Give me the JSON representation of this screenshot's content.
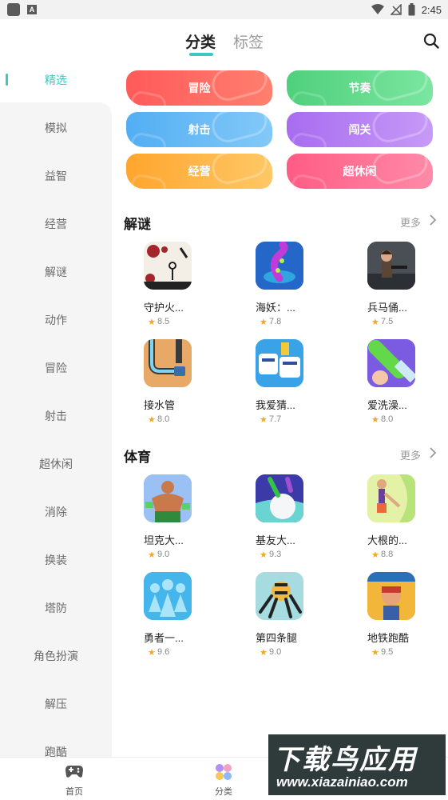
{
  "status_bar": {
    "time": "2:45"
  },
  "header": {
    "tabs": [
      {
        "label": "分类"
      },
      {
        "label": "标签"
      }
    ]
  },
  "sidebar": {
    "items": [
      {
        "label": "精选"
      },
      {
        "label": "模拟"
      },
      {
        "label": "益智"
      },
      {
        "label": "经营"
      },
      {
        "label": "解谜"
      },
      {
        "label": "动作"
      },
      {
        "label": "冒险"
      },
      {
        "label": "射击"
      },
      {
        "label": "超休闲"
      },
      {
        "label": "消除"
      },
      {
        "label": "换装"
      },
      {
        "label": "塔防"
      },
      {
        "label": "角色扮演"
      },
      {
        "label": "解压"
      },
      {
        "label": "跑酷"
      }
    ]
  },
  "categories": [
    {
      "label": "冒险",
      "color": "#ff6464"
    },
    {
      "label": "节奏",
      "color": "#5cd68a"
    },
    {
      "label": "射击",
      "color": "#5fb8f5"
    },
    {
      "label": "闯关",
      "color": "#b27bf2"
    },
    {
      "label": "经营",
      "color": "#ffb23e"
    },
    {
      "label": "超休闲",
      "color": "#ff6a8e"
    }
  ],
  "sections": [
    {
      "title": "解谜",
      "more": "更多",
      "games": [
        {
          "name": "守护火...",
          "score": "8.5",
          "icon": "stickman-icon"
        },
        {
          "name": "海妖：...",
          "score": "7.8",
          "icon": "octopus-icon"
        },
        {
          "name": "兵马俑...",
          "score": "7.5",
          "icon": "soldier-icon"
        },
        {
          "name": "接水管",
          "score": "8.0",
          "icon": "pipe-icon"
        },
        {
          "name": "我爱猜...",
          "score": "7.7",
          "icon": "puzzle-text-icon"
        },
        {
          "name": "爱洗澡...",
          "score": "8.0",
          "icon": "cleaning-icon"
        }
      ]
    },
    {
      "title": "体育",
      "more": "更多",
      "games": [
        {
          "name": "坦克大...",
          "score": "9.0",
          "icon": "muscle-man-icon"
        },
        {
          "name": "基友大...",
          "score": "9.3",
          "icon": "snowball-icon"
        },
        {
          "name": "大根的...",
          "score": "8.8",
          "icon": "runner-icon"
        },
        {
          "name": "勇者一...",
          "score": "9.6",
          "icon": "crowd-icon"
        },
        {
          "name": "第四条腿",
          "score": "9.0",
          "icon": "robot-spider-icon"
        },
        {
          "name": "地铁跑酷",
          "score": "9.5",
          "icon": "subway-icon"
        }
      ]
    }
  ],
  "bottom_nav": [
    {
      "label": "首页",
      "icon": "gamepad-icon"
    },
    {
      "label": "分类",
      "icon": "category-icon"
    }
  ],
  "watermark": {
    "title": "下载鸟应用",
    "url": "www.xiazainiao.com"
  },
  "colors": {
    "accent": "#3cc7c0",
    "star": "#f5a623"
  }
}
